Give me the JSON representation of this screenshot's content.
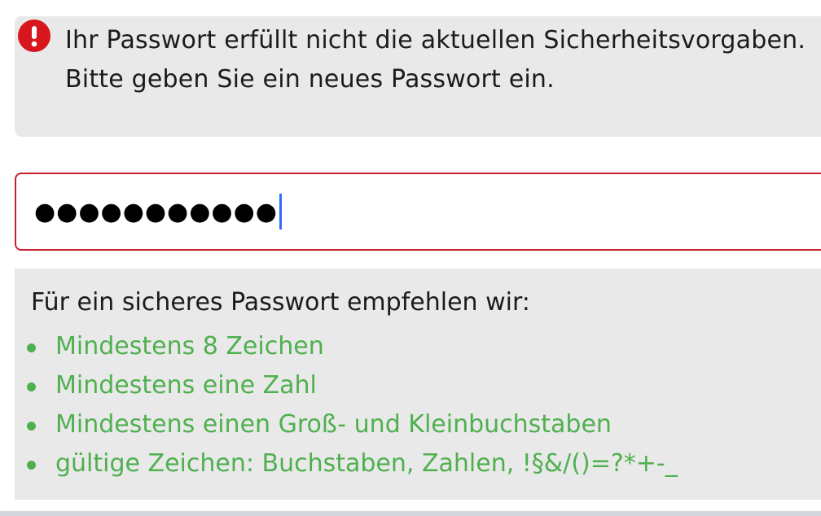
{
  "alert": {
    "icon": "exclamation-icon",
    "icon_glyph": "!",
    "message": "Ihr Passwort erfüllt nicht die aktuellen Sicherheitsvorgaben. Bitte geben Sie ein neues Passwort ein.",
    "color": "#d7161d"
  },
  "password_field": {
    "value": "●●●●●●●●●●●",
    "border_color": "#c8202a"
  },
  "recommendations": {
    "title": "Für ein sicheres Passwort empfehlen wir:",
    "color": "#4fb04f",
    "items": [
      "Mindestens 8 Zeichen",
      "Mindestens eine Zahl",
      "Mindestens einen Groß- und Kleinbuchstaben",
      "gültige Zeichen: Buchstaben, Zahlen, !§&/()=?*+-_"
    ]
  }
}
